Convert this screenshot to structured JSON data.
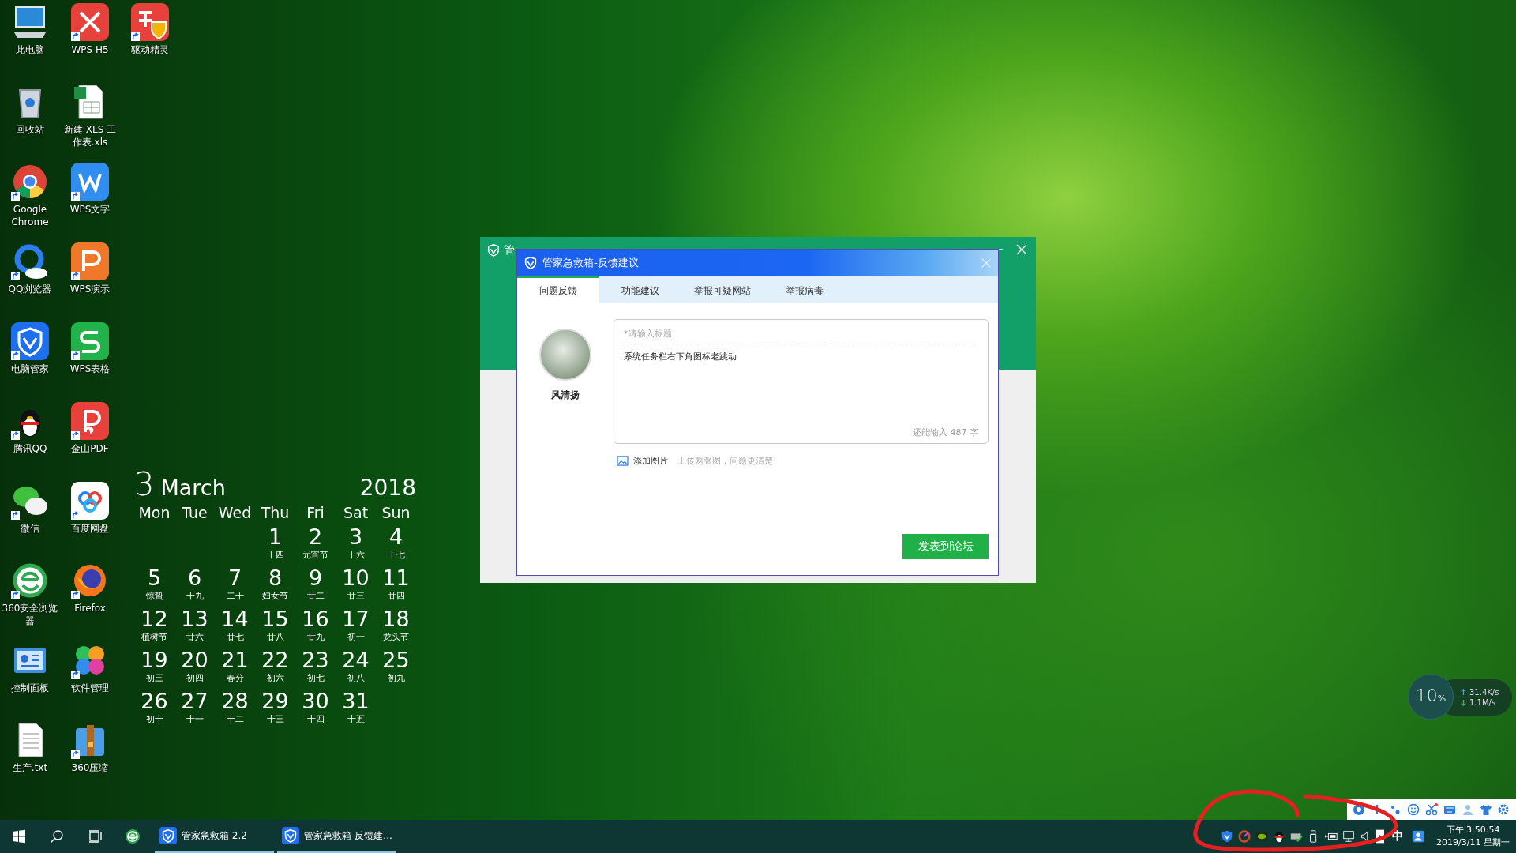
{
  "desktop_icons": [
    {
      "label": "此电脑",
      "kind": "pc",
      "shortcut": false
    },
    {
      "label": "回收站",
      "kind": "recycle",
      "shortcut": false
    },
    {
      "label": "Google Chrome",
      "kind": "chrome",
      "shortcut": true
    },
    {
      "label": "QQ浏览器",
      "kind": "qqbrowser",
      "shortcut": true
    },
    {
      "label": "电脑管家",
      "kind": "shield",
      "shortcut": true
    },
    {
      "label": "腾讯QQ",
      "kind": "penguin",
      "shortcut": true
    },
    {
      "label": "微信",
      "kind": "wechat",
      "shortcut": true
    },
    {
      "label": "360安全浏览器",
      "kind": "ie360",
      "shortcut": true
    },
    {
      "label": "控制面板",
      "kind": "panel",
      "shortcut": false
    },
    {
      "label": "生产.txt",
      "kind": "txt",
      "shortcut": false
    },
    {
      "label": "WPS H5",
      "kind": "wpsh5",
      "shortcut": true
    },
    {
      "label": "新建 XLS 工作表.xls",
      "kind": "xls",
      "shortcut": false
    },
    {
      "label": "WPS文字",
      "kind": "wpsw",
      "shortcut": true
    },
    {
      "label": "WPS演示",
      "kind": "wpsp",
      "shortcut": true
    },
    {
      "label": "WPS表格",
      "kind": "wpss",
      "shortcut": true
    },
    {
      "label": "金山PDF",
      "kind": "pdf",
      "shortcut": true
    },
    {
      "label": "百度网盘",
      "kind": "baidu",
      "shortcut": true
    },
    {
      "label": "Firefox",
      "kind": "firefox",
      "shortcut": true
    },
    {
      "label": "软件管理",
      "kind": "softmgr",
      "shortcut": true
    },
    {
      "label": "360压缩",
      "kind": "zip",
      "shortcut": true
    },
    {
      "label": "驱动精灵",
      "kind": "driver",
      "shortcut": true
    }
  ],
  "calendar": {
    "day": "3",
    "month": "March",
    "year": "2018",
    "weekdays": [
      "Mon",
      "Tue",
      "Wed",
      "Thu",
      "Fri",
      "Sat",
      "Sun"
    ],
    "weeks": [
      [
        {
          "date": "1",
          "lunar": "十四"
        },
        {
          "date": "2",
          "lunar": "元宵节"
        },
        {
          "date": "3",
          "lunar": "十六"
        },
        {
          "date": "4",
          "lunar": "十七"
        }
      ],
      [
        {
          "date": "5",
          "lunar": "惊蛰"
        },
        {
          "date": "6",
          "lunar": "十九"
        },
        {
          "date": "7",
          "lunar": "二十"
        },
        {
          "date": "8",
          "lunar": "妇女节"
        },
        {
          "date": "9",
          "lunar": "廿二"
        },
        {
          "date": "10",
          "lunar": "廿三"
        },
        {
          "date": "11",
          "lunar": "廿四"
        }
      ],
      [
        {
          "date": "12",
          "lunar": "植树节"
        },
        {
          "date": "13",
          "lunar": "廿六"
        },
        {
          "date": "14",
          "lunar": "廿七"
        },
        {
          "date": "15",
          "lunar": "廿八"
        },
        {
          "date": "16",
          "lunar": "廿九"
        },
        {
          "date": "17",
          "lunar": "初一"
        },
        {
          "date": "18",
          "lunar": "龙头节"
        }
      ],
      [
        {
          "date": "19",
          "lunar": "初三"
        },
        {
          "date": "20",
          "lunar": "初四"
        },
        {
          "date": "21",
          "lunar": "春分"
        },
        {
          "date": "22",
          "lunar": "初六"
        },
        {
          "date": "23",
          "lunar": "初七"
        },
        {
          "date": "24",
          "lunar": "初八"
        },
        {
          "date": "25",
          "lunar": "初九"
        }
      ],
      [
        {
          "date": "26",
          "lunar": "初十"
        },
        {
          "date": "27",
          "lunar": "十一"
        },
        {
          "date": "28",
          "lunar": "十二"
        },
        {
          "date": "29",
          "lunar": "十三"
        },
        {
          "date": "30",
          "lunar": "十四"
        },
        {
          "date": "31",
          "lunar": "十五"
        }
      ]
    ]
  },
  "back_window": {
    "title": "管"
  },
  "feedback_dialog": {
    "title": "管家急救箱-反馈建议",
    "tabs": [
      {
        "label": "问题反馈",
        "selected": true
      },
      {
        "label": "功能建议",
        "selected": false
      },
      {
        "label": "举报可疑网站",
        "selected": false
      },
      {
        "label": "举报病毒",
        "selected": false
      }
    ],
    "user_name": "风清扬",
    "title_field": {
      "placeholder": "*请输入标题"
    },
    "content_field": {
      "value": "系统任务栏右下角图标老跳动"
    },
    "char_counter": "还能输入 487 字",
    "add_image_link": "添加图片",
    "add_image_hint": "上传两张图，问题更清楚",
    "submit_button": "发表到论坛"
  },
  "net_meter": {
    "cpu": "10",
    "cpu_unit": "%",
    "upload": "31.4K/s",
    "download": "1.1M/s"
  },
  "taskbar": {
    "apps": [
      {
        "label": "管家急救箱 2.2",
        "running": true
      },
      {
        "label": "管家急救箱-反馈建...",
        "running": true
      }
    ],
    "ime": "中",
    "time": "下午 3:50:54",
    "date": "2019/3/11 星期一"
  }
}
